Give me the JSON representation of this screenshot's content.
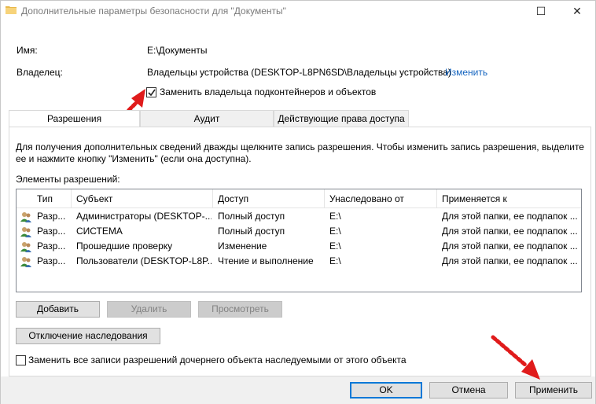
{
  "window": {
    "title": "Дополнительные параметры безопасности  для \"Документы\"",
    "maximize_glyph": "☐",
    "close_glyph": "✕"
  },
  "info": {
    "name_label": "Имя:",
    "name_value": "E:\\Документы",
    "owner_label": "Владелец:",
    "owner_value": "Владельцы устройства (DESKTOP-L8PN6SD\\Владельцы устройства)",
    "owner_change_link": "Изменить",
    "replace_owner_label": "Заменить владельца подконтейнеров и объектов",
    "replace_owner_checked": true
  },
  "tabs": [
    {
      "label": "Разрешения",
      "active": true
    },
    {
      "label": "Аудит",
      "active": false
    },
    {
      "label": "Действующие права доступа",
      "active": false
    }
  ],
  "panel": {
    "help_text_1": "Для получения дополнительных сведений дважды щелкните запись разрешения. Чтобы изменить запись разрешения, выделите",
    "help_text_2": "ее и нажмите кнопку \"Изменить\" (если она доступна).",
    "entries_label": "Элементы разрешений:"
  },
  "table": {
    "columns": [
      "Тип",
      "Субъект",
      "Доступ",
      "Унаследовано от",
      "Применяется к"
    ],
    "rows": [
      {
        "type": "Разр...",
        "subject": "Администраторы (DESKTOP-...",
        "access": "Полный доступ",
        "inherited": "E:\\",
        "applies": "Для этой папки, ее подпапок ..."
      },
      {
        "type": "Разр...",
        "subject": "СИСТЕМА",
        "access": "Полный доступ",
        "inherited": "E:\\",
        "applies": "Для этой папки, ее подпапок ..."
      },
      {
        "type": "Разр...",
        "subject": "Прошедшие проверку",
        "access": "Изменение",
        "inherited": "E:\\",
        "applies": "Для этой папки, ее подпапок ..."
      },
      {
        "type": "Разр...",
        "subject": "Пользователи (DESKTOP-L8P...",
        "access": "Чтение и выполнение",
        "inherited": "E:\\",
        "applies": "Для этой папки, ее подпапок ..."
      }
    ]
  },
  "buttons": {
    "add": "Добавить",
    "remove": "Удалить",
    "view": "Просмотреть",
    "disable_inheritance": "Отключение наследования",
    "ok": "OK",
    "cancel": "Отмена",
    "apply": "Применить"
  },
  "replace_child": {
    "label": "Заменить все записи разрешений дочернего объекта наследуемыми от этого объекта",
    "checked": false
  },
  "colors": {
    "link": "#1565c0",
    "annotation_arrow": "#e01b1b",
    "focus_border": "#0078d7"
  }
}
